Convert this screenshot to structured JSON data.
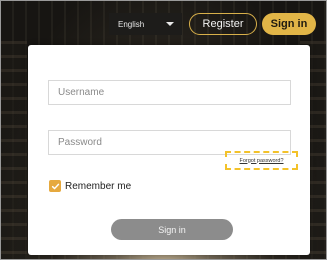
{
  "topbar": {
    "language": "English",
    "register_label": "Register",
    "signin_label": "Sign in"
  },
  "form": {
    "username_placeholder": "Username",
    "password_placeholder": "Password",
    "forgot_label": "Forgot password?",
    "remember_label": "Remember me",
    "remember_checked": true,
    "submit_label": "Sign in"
  },
  "colors": {
    "accent": "#e1b547",
    "checkbox": "#e6a93e",
    "highlight_dashed": "#f3c22a",
    "submit_button": "#8c8c8c"
  },
  "icons": {
    "language_dropdown": "caret-down-icon",
    "remember_checkbox": "check-icon"
  }
}
